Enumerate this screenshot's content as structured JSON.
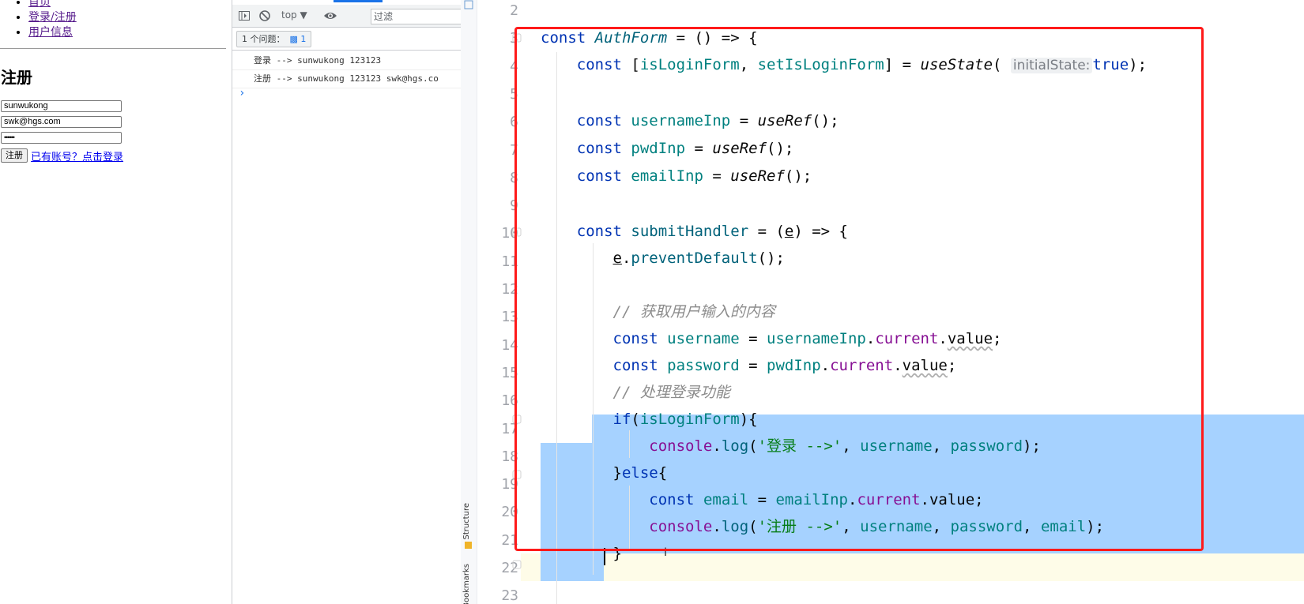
{
  "webpage": {
    "nav": [
      {
        "label": "首页"
      },
      {
        "label": "登录/注册"
      },
      {
        "label": "用户信息"
      }
    ],
    "title": "注册",
    "form": {
      "username_value": "sunwukong",
      "email_value": "swk@hgs.com",
      "password_mask": "••••••",
      "submit_label": "注册",
      "switch_link": "已有账号？点击登录"
    }
  },
  "devtools": {
    "context": "top ▼",
    "filter_placeholder": "过滤",
    "issues_label": "1 个问题：",
    "issues_count": "1",
    "logs": [
      "登录 --> sunwukong 123123",
      "注册 --> sunwukong 123123 swk@hgs.co"
    ],
    "prompt": "›"
  },
  "ide": {
    "side_labels": {
      "structure": "Structure",
      "bookmarks": "Bookmarks"
    },
    "line_numbers": [
      "2",
      "3",
      "4",
      "5",
      "6",
      "7",
      "8",
      "9",
      "10",
      "11",
      "12",
      "13",
      "14",
      "15",
      "16",
      "17",
      "18",
      "19",
      "20",
      "21",
      "22",
      "23"
    ],
    "inlay_hint": "initialState:",
    "colors": {
      "selection": "#a6d2ff",
      "highlight_box": "#ff1a1a",
      "keyword": "#0033b3",
      "string": "#067d17",
      "property": "#871094"
    }
  }
}
